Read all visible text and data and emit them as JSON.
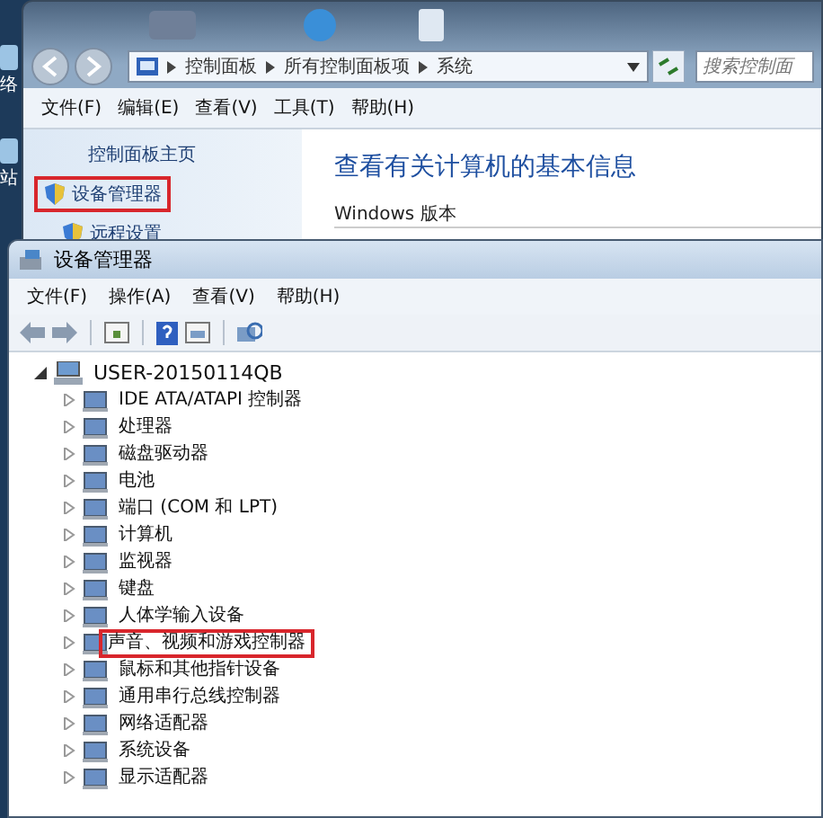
{
  "desktop": {
    "labels": [
      "络",
      "站"
    ]
  },
  "back_window": {
    "address": {
      "crumbs": [
        "控制面板",
        "所有控制面板项",
        "系统"
      ]
    },
    "search": {
      "placeholder": "搜索控制面"
    },
    "menu": [
      "文件(F)",
      "编辑(E)",
      "查看(V)",
      "工具(T)",
      "帮助(H)"
    ],
    "sidebar": {
      "items": [
        {
          "label": "控制面板主页",
          "highlighted": false,
          "kind": "plain"
        },
        {
          "label": "设备管理器",
          "highlighted": true,
          "kind": "shield"
        },
        {
          "label": "远程设置",
          "highlighted": false,
          "kind": "shield"
        }
      ]
    },
    "heading": "查看有关计算机的基本信息",
    "section": "Windows 版本"
  },
  "front_window": {
    "title": "设备管理器",
    "menu": [
      "文件(F)",
      "操作(A)",
      "查看(V)",
      "帮助(H)"
    ],
    "tree": {
      "label": "USER-20150114QB",
      "expanded": true,
      "children": [
        {
          "label": "IDE ATA/ATAPI 控制器",
          "expanded": false,
          "highlighted": false
        },
        {
          "label": "处理器",
          "expanded": false,
          "highlighted": false
        },
        {
          "label": "磁盘驱动器",
          "expanded": false,
          "highlighted": false
        },
        {
          "label": "电池",
          "expanded": false,
          "highlighted": false
        },
        {
          "label": "端口 (COM 和 LPT)",
          "expanded": false,
          "highlighted": false
        },
        {
          "label": "计算机",
          "expanded": false,
          "highlighted": false
        },
        {
          "label": "监视器",
          "expanded": false,
          "highlighted": false
        },
        {
          "label": "键盘",
          "expanded": false,
          "highlighted": false
        },
        {
          "label": "人体学输入设备",
          "expanded": false,
          "highlighted": false
        },
        {
          "label": "声音、视频和游戏控制器",
          "expanded": false,
          "highlighted": true
        },
        {
          "label": "鼠标和其他指针设备",
          "expanded": false,
          "highlighted": false
        },
        {
          "label": "通用串行总线控制器",
          "expanded": false,
          "highlighted": false
        },
        {
          "label": "网络适配器",
          "expanded": false,
          "highlighted": false
        },
        {
          "label": "系统设备",
          "expanded": false,
          "highlighted": false
        },
        {
          "label": "显示适配器",
          "expanded": false,
          "highlighted": false
        }
      ]
    }
  }
}
